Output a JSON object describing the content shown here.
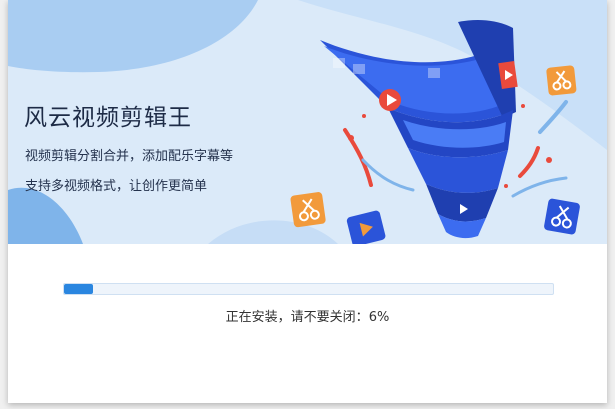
{
  "app": {
    "title": "风云视频剪辑王",
    "tagline_1": "视频剪辑分割合并，添加配乐字幕等",
    "tagline_2": "支持多视频格式，让创作更简单"
  },
  "install": {
    "status_text": "正在安装，请不要关闭：",
    "percent_text": "6%",
    "progress": 0.06
  },
  "icons": {
    "funnel": "video-funnel-illustration",
    "scissors": "scissors-icon",
    "play": "play-icon"
  },
  "colors": {
    "banner_bg": "#dbeaf9",
    "progress_fill": "#2a86e0",
    "funnel_blue": "#2b54d9",
    "accent_orange": "#f29a3b",
    "accent_red": "#e94a3c"
  }
}
